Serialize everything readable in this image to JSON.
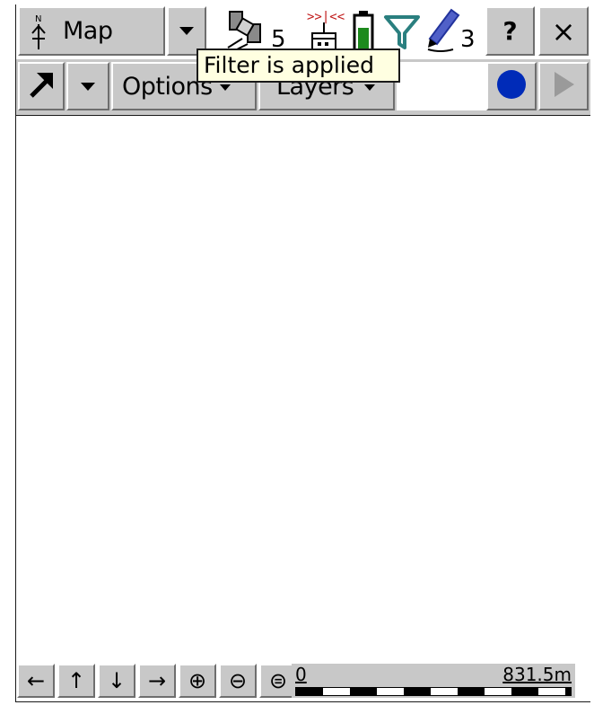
{
  "toolbar": {
    "view_label": "Map",
    "satellite_count": "5",
    "pen_count": "3",
    "help_label": "?",
    "close_label": "×"
  },
  "secondary_toolbar": {
    "options_label": "Options",
    "layers_label": "Layers"
  },
  "tooltip": {
    "text": "Filter is applied"
  },
  "scale": {
    "start_label": "0",
    "end_label": "831.5m"
  },
  "nav": {
    "left": "←",
    "up": "↑",
    "down": "↓",
    "right": "→",
    "zoom_in": "⊕",
    "zoom_out": "⊖",
    "zoom_extents": "⊜"
  },
  "colors": {
    "record_dot": "#002bb8",
    "battery_fill": "#1d8a1d",
    "filter_icon": "#2a7f7f",
    "pen_icon": "#22339c",
    "gps_antenna": "#c01818"
  },
  "icons": [
    "north-arrow-icon",
    "dropdown-arrow-icon",
    "satellite-icon",
    "gps-receiver-icon",
    "battery-icon",
    "filter-icon",
    "pen-icon",
    "pointer-arrow-icon",
    "record-icon",
    "play-icon"
  ]
}
